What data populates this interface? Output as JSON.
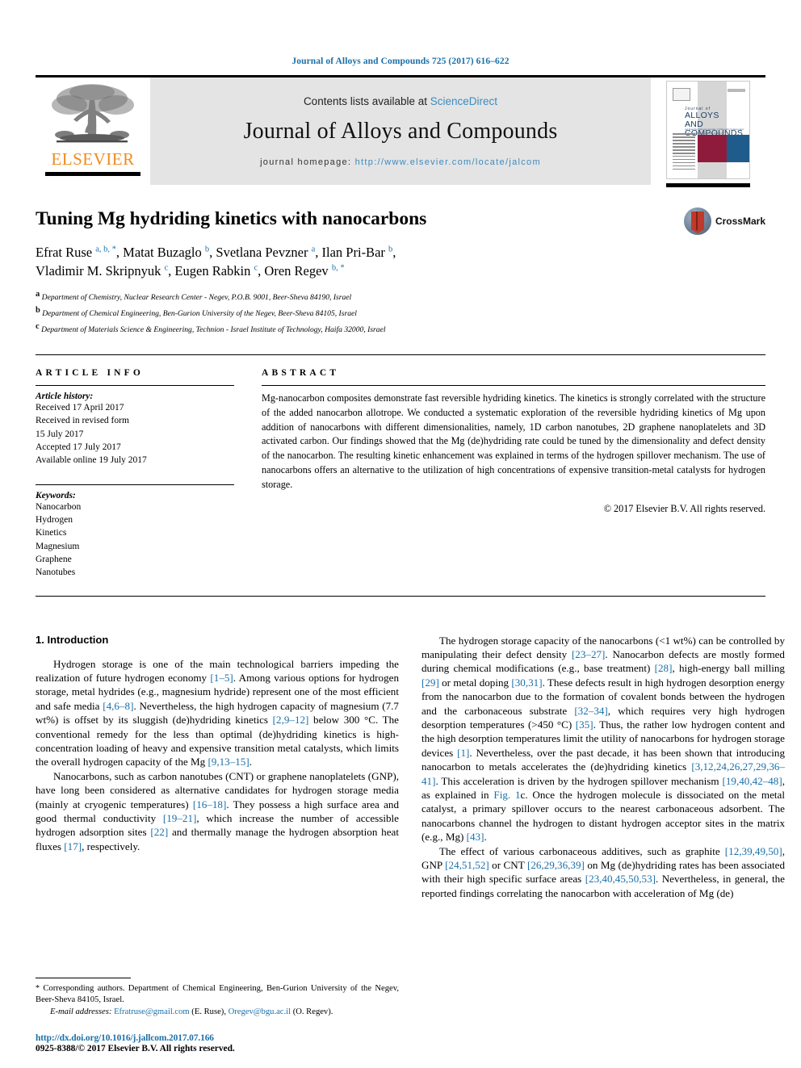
{
  "running_head": "Journal of Alloys and Compounds 725 (2017) 616–622",
  "masthead": {
    "contents_prefix": "Contents lists available at ",
    "sciencedirect": "ScienceDirect",
    "journal_name": "Journal of Alloys and Compounds",
    "homepage_label": "journal homepage: ",
    "homepage_url": "http://www.elsevier.com/locate/jalcom",
    "publisher_wordmark": "ELSEVIER",
    "cover": {
      "line1": "Journal of",
      "line2": "ALLOYS",
      "line3": "AND COMPOUNDS",
      "subtitle": "An Interdisciplinary Journal of Materials Science and Solid-state Chemistry and Physics"
    }
  },
  "article": {
    "title": "Tuning Mg hydriding kinetics with nanocarbons",
    "authors_line1_a": "Efrat Ruse ",
    "authors_line1_a_sup": "a, b, *",
    "authors_line1_b": ", Matat Buzaglo ",
    "authors_line1_b_sup": "b",
    "authors_line1_c": ", Svetlana Pevzner ",
    "authors_line1_c_sup": "a",
    "authors_line1_d": ", Ilan Pri-Bar ",
    "authors_line1_d_sup": "b",
    "authors_line1_e": ",",
    "authors_line2_a": "Vladimir M. Skripnyuk ",
    "authors_line2_a_sup": "c",
    "authors_line2_b": ", Eugen Rabkin ",
    "authors_line2_b_sup": "c",
    "authors_line2_c": ", Oren Regev ",
    "authors_line2_c_sup": "b, *",
    "affiliations": [
      {
        "mark": "a",
        "text": "Department of Chemistry, Nuclear Research Center - Negev, P.O.B. 9001, Beer-Sheva 84190, Israel"
      },
      {
        "mark": "b",
        "text": "Department of Chemical Engineering, Ben-Gurion University of the Negev, Beer-Sheva 84105, Israel"
      },
      {
        "mark": "c",
        "text": "Department of Materials Science & Engineering, Technion - Israel Institute of Technology, Haifa 32000, Israel"
      }
    ],
    "crossmark_label": "CrossMark"
  },
  "article_info": {
    "heading": "ARTICLE INFO",
    "history_label": "Article history:",
    "history": [
      "Received 17 April 2017",
      "Received in revised form",
      "15 July 2017",
      "Accepted 17 July 2017",
      "Available online 19 July 2017"
    ],
    "keywords_label": "Keywords:",
    "keywords": [
      "Nanocarbon",
      "Hydrogen",
      "Kinetics",
      "Magnesium",
      "Graphene",
      "Nanotubes"
    ]
  },
  "abstract": {
    "heading": "ABSTRACT",
    "text": "Mg-nanocarbon composites demonstrate fast reversible hydriding kinetics. The kinetics is strongly correlated with the structure of the added nanocarbon allotrope. We conducted a systematic exploration of the reversible hydriding kinetics of Mg upon addition of nanocarbons with different dimensionalities, namely, 1D carbon nanotubes, 2D graphene nanoplatelets and 3D activated carbon. Our findings showed that the Mg (de)hydriding rate could be tuned by the dimensionality and defect density of the nanocarbon. The resulting kinetic enhancement was explained in terms of the hydrogen spillover mechanism. The use of nanocarbons offers an alternative to the utilization of high concentrations of expensive transition-metal catalysts for hydrogen storage.",
    "copyright": "© 2017 Elsevier B.V. All rights reserved."
  },
  "body": {
    "section_heading": "1. Introduction",
    "left_paragraphs": [
      {
        "parts": [
          {
            "t": "Hydrogen storage is one of the main technological barriers impeding the realization of future hydrogen economy "
          },
          {
            "t": "[1–5]",
            "ref": true
          },
          {
            "t": ". Among various options for hydrogen storage, metal hydrides (e.g., magnesium hydride) represent one of the most efficient and safe media "
          },
          {
            "t": "[4,6–8]",
            "ref": true
          },
          {
            "t": ". Nevertheless, the high hydrogen capacity of magnesium (7.7 wt%) is offset by its sluggish (de)hydriding kinetics "
          },
          {
            "t": "[2,9–12]",
            "ref": true
          },
          {
            "t": " below 300 °C. The conventional remedy for the less than optimal (de)hydriding kinetics is high-concentration loading of heavy and expensive transition metal catalysts, which limits the overall hydrogen capacity of the Mg "
          },
          {
            "t": "[9,13–15]",
            "ref": true
          },
          {
            "t": "."
          }
        ]
      },
      {
        "parts": [
          {
            "t": "Nanocarbons, such as carbon nanotubes (CNT) or graphene nanoplatelets (GNP), have long been considered as alternative candidates for hydrogen storage media (mainly at cryogenic temperatures) "
          },
          {
            "t": "[16–18]",
            "ref": true
          },
          {
            "t": ". They possess a high surface area and good thermal conductivity "
          },
          {
            "t": "[19–21]",
            "ref": true
          },
          {
            "t": ", which increase the number of accessible hydrogen adsorption sites "
          },
          {
            "t": "[22]",
            "ref": true
          },
          {
            "t": " and thermally manage the hydrogen absorption heat fluxes "
          },
          {
            "t": "[17]",
            "ref": true
          },
          {
            "t": ", respectively."
          }
        ]
      }
    ],
    "right_paragraphs": [
      {
        "parts": [
          {
            "t": "The hydrogen storage capacity of the nanocarbons (<1 wt%) can be controlled by manipulating their defect density "
          },
          {
            "t": "[23–27]",
            "ref": true
          },
          {
            "t": ". Nanocarbon defects are mostly formed during chemical modifications (e.g., base treatment) "
          },
          {
            "t": "[28]",
            "ref": true
          },
          {
            "t": ", high-energy ball milling "
          },
          {
            "t": "[29]",
            "ref": true
          },
          {
            "t": " or metal doping "
          },
          {
            "t": "[30,31]",
            "ref": true
          },
          {
            "t": ". These defects result in high hydrogen desorption energy from the nanocarbon due to the formation of covalent bonds between the hydrogen and the carbonaceous substrate "
          },
          {
            "t": "[32–34]",
            "ref": true
          },
          {
            "t": ", which requires very high hydrogen desorption temperatures (>450 °C) "
          },
          {
            "t": "[35]",
            "ref": true
          },
          {
            "t": ". Thus, the rather low hydrogen content and the high desorption temperatures limit the utility of nanocarbons for hydrogen storage devices "
          },
          {
            "t": "[1]",
            "ref": true
          },
          {
            "t": ". Nevertheless, over the past decade, it has been shown that introducing nanocarbon to metals accelerates the (de)hydriding kinetics "
          },
          {
            "t": "[3,12,24,26,27,29,36–41]",
            "ref": true
          },
          {
            "t": ". This acceleration is driven by the hydrogen spillover mechanism "
          },
          {
            "t": "[19,40,42–48]",
            "ref": true
          },
          {
            "t": ", as explained in "
          },
          {
            "t": "Fig. 1",
            "ref": true
          },
          {
            "t": "c. Once the hydrogen molecule is dissociated on the metal catalyst, a primary spillover occurs to the nearest carbonaceous adsorbent. The nanocarbons channel the hydrogen to distant hydrogen acceptor sites in the matrix (e.g., Mg) "
          },
          {
            "t": "[43]",
            "ref": true
          },
          {
            "t": "."
          }
        ]
      },
      {
        "parts": [
          {
            "t": "The effect of various carbonaceous additives, such as graphite "
          },
          {
            "t": "[12,39,49,50]",
            "ref": true
          },
          {
            "t": ", GNP "
          },
          {
            "t": "[24,51,52]",
            "ref": true
          },
          {
            "t": " or CNT "
          },
          {
            "t": "[26,29,36,39]",
            "ref": true
          },
          {
            "t": " on Mg (de)hydriding rates has been associated with their high specific surface areas "
          },
          {
            "t": "[23,40,45,50,53]",
            "ref": true
          },
          {
            "t": ". Nevertheless, in general, the reported findings correlating the nanocarbon with acceleration of Mg (de)"
          }
        ]
      }
    ]
  },
  "footnotes": {
    "corresponding_star": "*",
    "corresponding": " Corresponding authors. Department of Chemical Engineering, Ben-Gurion University of the Negev, Beer-Sheva 84105, Israel.",
    "email_label": "E-mail addresses:",
    "email1": "Efratruse@gmail.com",
    "email1_owner": " (E. Ruse), ",
    "email2": "Oregev@bgu.ac.il",
    "email2_owner": " (O. Regev).",
    "doi": "http://dx.doi.org/10.1016/j.jallcom.2017.07.166",
    "issn_line": "0925-8388/© 2017 Elsevier B.V. All rights reserved."
  },
  "colors": {
    "link_blue": "#1a6fa8",
    "elsevier_orange": "#f08a1e",
    "cover_red": "#8e1b3c",
    "cover_blue": "#1f5c8b"
  }
}
